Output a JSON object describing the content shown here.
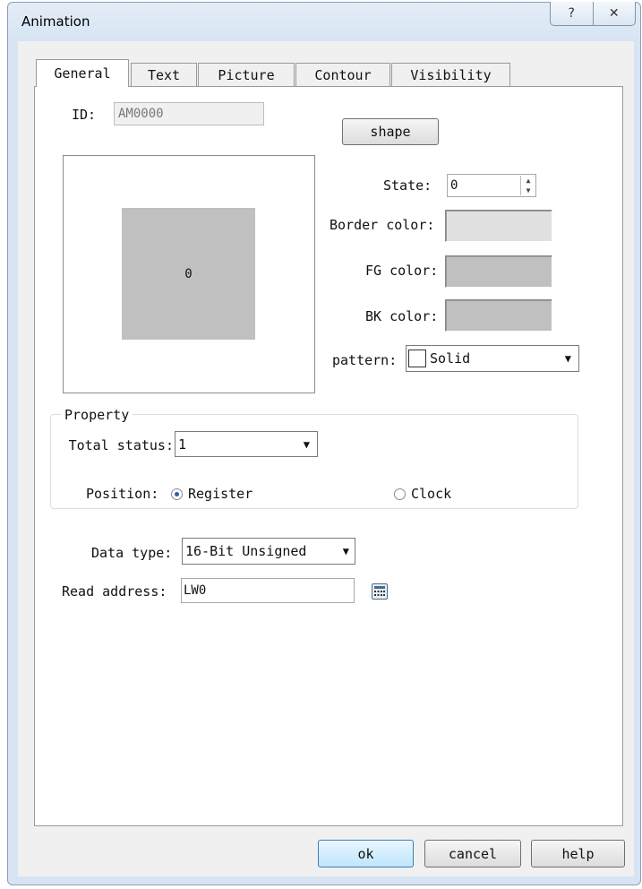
{
  "window": {
    "title": "Animation",
    "help_glyph": "?",
    "close_glyph": "✕"
  },
  "tabs": [
    {
      "label": "General",
      "active": true
    },
    {
      "label": "Text"
    },
    {
      "label": "Picture"
    },
    {
      "label": "Contour"
    },
    {
      "label": "Visibility"
    }
  ],
  "general": {
    "id_label": "ID:",
    "id_value": "AM0000",
    "shape_button": "shape",
    "preview_value": "0",
    "state_label": "State:",
    "state_value": "0",
    "border_color_label": "Border color:",
    "fg_color_label": "FG color:",
    "bk_color_label": "BK color:",
    "pattern_label": "pattern:",
    "pattern_value": "Solid"
  },
  "property": {
    "group_label": "Property",
    "total_status_label": "Total status:",
    "total_status_value": "1",
    "position_label": "Position:",
    "options": [
      "Register",
      "Clock"
    ],
    "selected": "Register"
  },
  "data_type": {
    "label": "Data type:",
    "value": "16-Bit Unsigned"
  },
  "read_address": {
    "label": "Read address:",
    "value": "LW0"
  },
  "buttons": {
    "ok": "ok",
    "cancel": "cancel",
    "help": "help"
  },
  "colors": {
    "border_color": "#e1e1e1",
    "fg_color": "#c0c0c0",
    "bk_color": "#c0c0c0",
    "preview_fill": "#c0c0c0"
  }
}
